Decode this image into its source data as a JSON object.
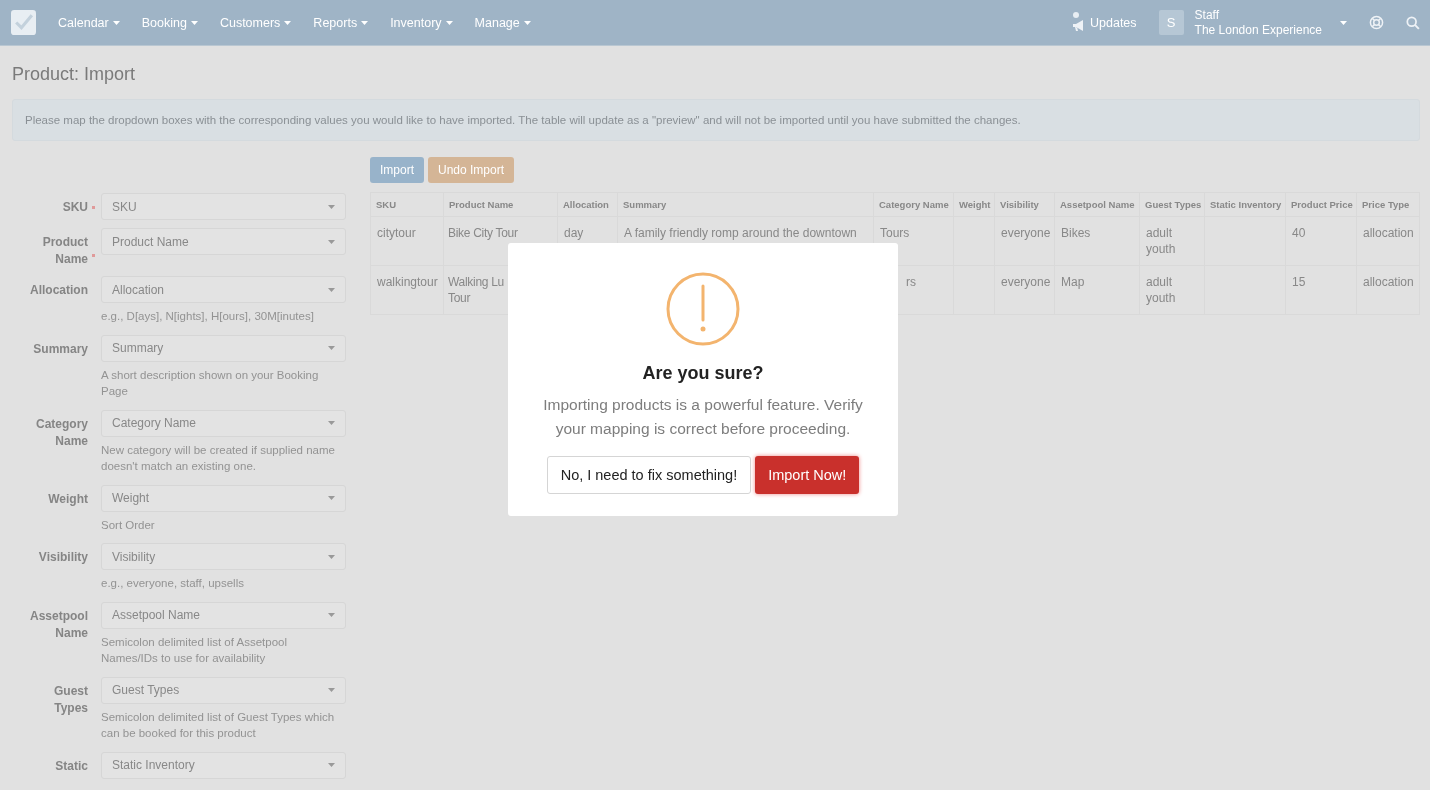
{
  "nav": {
    "menu": [
      {
        "label": "Calendar"
      },
      {
        "label": "Booking"
      },
      {
        "label": "Customers"
      },
      {
        "label": "Reports"
      },
      {
        "label": "Inventory"
      },
      {
        "label": "Manage"
      }
    ],
    "updates": {
      "label": "Updates"
    },
    "user": {
      "avatar": "S",
      "role": "Staff",
      "company": "The London Experience"
    }
  },
  "page_title": "Product: Import",
  "info": "Please map the dropdown boxes with the corresponding values you would like to have imported. The table will update as a \"preview\" and will not be imported until you have submitted the changes.",
  "actions": [
    {
      "label": "Import",
      "kind": "primary"
    },
    {
      "label": "Undo Import",
      "kind": "warning"
    }
  ],
  "fields": [
    {
      "label": "SKU",
      "required": true,
      "placeholder": "SKU"
    },
    {
      "label": "Product Name",
      "required": true,
      "placeholder": "Product Name"
    },
    {
      "label": "Allocation",
      "required": false,
      "placeholder": "Allocation",
      "help": "e.g., D[ays], N[ights], H[ours], 30M[inutes]"
    },
    {
      "label": "Summary",
      "required": false,
      "placeholder": "Summary",
      "help": "A short description shown on your Booking Page"
    },
    {
      "label": "Category Name",
      "required": false,
      "placeholder": "Category Name",
      "help": "New category will be created if supplied name doesn't match an existing one."
    },
    {
      "label": "Weight",
      "required": false,
      "placeholder": "Weight",
      "help": "Sort Order"
    },
    {
      "label": "Visibility",
      "required": false,
      "placeholder": "Visibility",
      "help": "e.g., everyone, staff, upsells"
    },
    {
      "label": "Assetpool Name",
      "required": false,
      "placeholder": "Assetpool Name",
      "help": "Semicolon delimited list of Assetpool Names/IDs to use for availability"
    },
    {
      "label": "Guest Types",
      "required": false,
      "placeholder": "Guest Types",
      "help": "Semicolon delimited list of Guest Types which can be booked for this product"
    },
    {
      "label": "Static",
      "required": false,
      "placeholder": "Static Inventory"
    }
  ],
  "table": {
    "columns": [
      "SKU",
      "Product Name",
      "Allocation",
      "Summary",
      "Category Name",
      "Weight",
      "Visibility",
      "Assetpool Name",
      "Guest Types",
      "Static Inventory",
      "Product Price",
      "Price Type"
    ],
    "rows": [
      [
        [
          "citytour"
        ],
        [
          "Bike City Tour"
        ],
        [
          "day"
        ],
        [
          "A family friendly romp around the downtown"
        ],
        [
          "Tours"
        ],
        [],
        [
          "everyone"
        ],
        [
          "Bikes"
        ],
        [
          "adult",
          "youth"
        ],
        [],
        [
          "40"
        ],
        [
          "allocation"
        ]
      ],
      [
        [
          "walkingtour"
        ],
        [
          "Walking Lu",
          "Tour"
        ],
        [],
        [],
        {
          "lines": [
            "rs"
          ],
          "covered": true
        },
        [],
        [
          "everyone"
        ],
        [
          "Map"
        ],
        [
          "adult",
          "youth"
        ],
        [],
        [
          "15"
        ],
        [
          "allocation"
        ]
      ]
    ]
  },
  "dialog": {
    "title": "Are you sure?",
    "message": "Importing products is a powerful feature. Verify your mapping is correct before proceeding.",
    "buttons": [
      {
        "label": "No, I need to fix something!",
        "kind": "cancel"
      },
      {
        "label": "Import Now!",
        "kind": "confirm"
      }
    ]
  }
}
